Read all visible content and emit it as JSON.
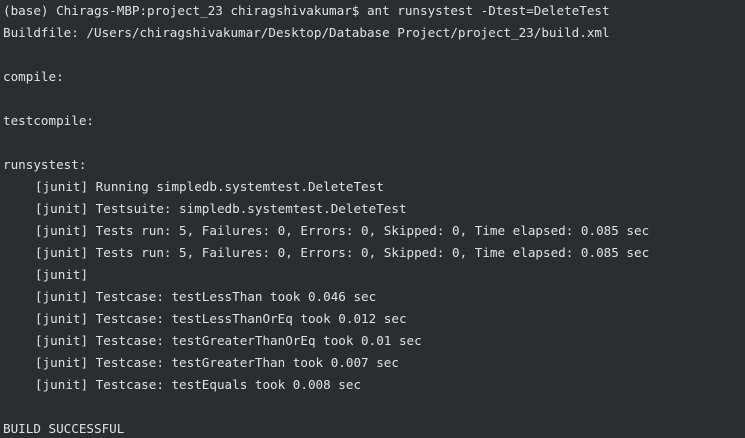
{
  "terminal": {
    "lines": [
      {
        "text": "(base) Chirags-MBP:project_23 chiragshivakumar$ ant runsystest -Dtest=DeleteTest",
        "indent": false
      },
      {
        "text": "Buildfile: /Users/chiragshivakumar/Desktop/Database Project/project_23/build.xml",
        "indent": false
      },
      {
        "text": "",
        "indent": false
      },
      {
        "text": "compile:",
        "indent": false
      },
      {
        "text": "",
        "indent": false
      },
      {
        "text": "testcompile:",
        "indent": false
      },
      {
        "text": "",
        "indent": false
      },
      {
        "text": "runsystest:",
        "indent": false
      },
      {
        "text": "[junit] Running simpledb.systemtest.DeleteTest",
        "indent": true
      },
      {
        "text": "[junit] Testsuite: simpledb.systemtest.DeleteTest",
        "indent": true
      },
      {
        "text": "[junit] Tests run: 5, Failures: 0, Errors: 0, Skipped: 0, Time elapsed: 0.085 sec",
        "indent": true
      },
      {
        "text": "[junit] Tests run: 5, Failures: 0, Errors: 0, Skipped: 0, Time elapsed: 0.085 sec",
        "indent": true
      },
      {
        "text": "[junit]",
        "indent": true
      },
      {
        "text": "[junit] Testcase: testLessThan took 0.046 sec",
        "indent": true
      },
      {
        "text": "[junit] Testcase: testLessThanOrEq took 0.012 sec",
        "indent": true
      },
      {
        "text": "[junit] Testcase: testGreaterThanOrEq took 0.01 sec",
        "indent": true
      },
      {
        "text": "[junit] Testcase: testGreaterThan took 0.007 sec",
        "indent": true
      },
      {
        "text": "[junit] Testcase: testEquals took 0.008 sec",
        "indent": true
      },
      {
        "text": "",
        "indent": false
      },
      {
        "text": "BUILD SUCCESSFUL",
        "indent": false
      }
    ]
  },
  "colors": {
    "background": "#2b2d30",
    "text": "#dfe1e5"
  }
}
